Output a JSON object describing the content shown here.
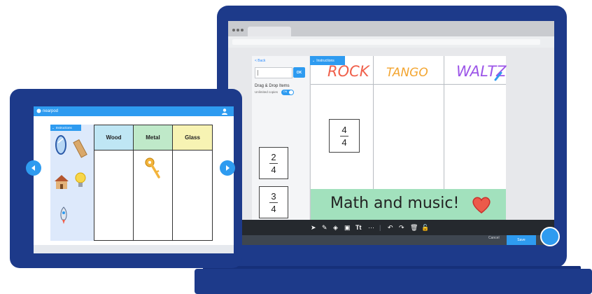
{
  "laptop": {
    "left_panel": {
      "back_label": "< Back",
      "input_value": "",
      "ok_label": "OK",
      "drag_drop_title": "Drag & Drop Items",
      "unlimited_label": "Unlimited copies",
      "toggle_label": "ON",
      "cards": [
        {
          "numerator": "2",
          "denominator": "4"
        },
        {
          "numerator": "3",
          "denominator": "4"
        }
      ]
    },
    "board": {
      "instructions_label": "Instructions",
      "columns": [
        "ROCK",
        "TANGO",
        "WALTZ"
      ],
      "column_colors": [
        "#f0604b",
        "#f3a530",
        "#9c55e8"
      ],
      "placed_card": {
        "numerator": "4",
        "denominator": "4"
      },
      "banner_text": "Math and music!",
      "banner_color": "#a2e1bd"
    },
    "toolbar": {
      "icons": [
        "pointer-icon",
        "pen-icon",
        "eraser-icon",
        "image-icon",
        "text-icon",
        "more-icon",
        "undo-icon",
        "redo-icon",
        "trash-icon",
        "lock-icon"
      ],
      "text_tool_label": "Tt",
      "more_label": "···"
    },
    "footer": {
      "cancel_label": "Cancel",
      "save_label": "Save"
    },
    "accent": "#2e9bf0"
  },
  "tablet": {
    "logo_text": "nearpod",
    "instructions_label": "Instructions",
    "table_headers": [
      "Wood",
      "Metal",
      "Glass"
    ],
    "header_colors": [
      "#bfe6f4",
      "#bfe9c9",
      "#f7f3b3"
    ],
    "strip_items": [
      "mirror-icon",
      "plank-icon",
      "house-icon",
      "lightbulb-icon",
      "rocket-icon"
    ],
    "placed_items": [
      "key-icon"
    ]
  }
}
